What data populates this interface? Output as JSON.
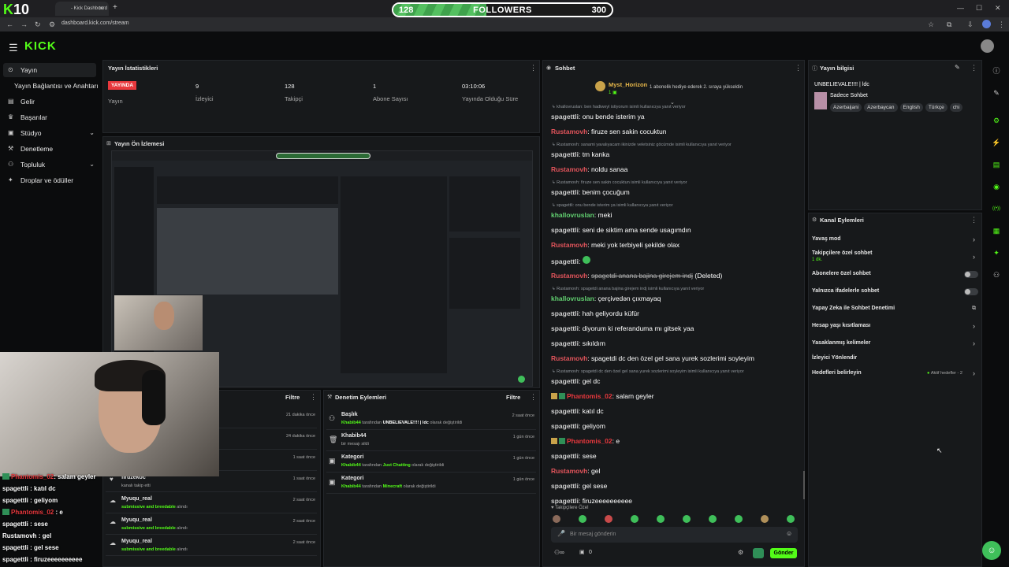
{
  "browser": {
    "tab_title": "- Kick Dashboard",
    "url": "dashboard.kick.com/stream",
    "overlay_logo_number": "10"
  },
  "followers_goal": {
    "current": "128",
    "label": "FOLLOWERS",
    "target": "300",
    "progress_fraction": 0.427
  },
  "app": {
    "logo": "KICK"
  },
  "sidebar": {
    "items": [
      {
        "label": "Yayın",
        "icon": "broadcast-icon",
        "active": true
      },
      {
        "label": "Yayın Bağlantısı ve Anahtarı",
        "icon": "",
        "active": false
      },
      {
        "label": "Gelir",
        "icon": "wallet-icon",
        "active": false
      },
      {
        "label": "Başarılar",
        "icon": "trophy-icon",
        "active": false
      },
      {
        "label": "Stüdyo",
        "icon": "studio-icon",
        "active": false,
        "chevron": true
      },
      {
        "label": "Denetleme",
        "icon": "hammer-icon",
        "active": false
      },
      {
        "label": "Topluluk",
        "icon": "people-icon",
        "active": false,
        "chevron": true
      },
      {
        "label": "Droplar ve ödüller",
        "icon": "gift-icon",
        "active": false
      }
    ]
  },
  "stream_stats": {
    "title": "Yayın İstatistikleri",
    "live_badge": "YAYINDA",
    "status_label": "Yayın",
    "viewers": "9",
    "viewers_label": "İzleyici",
    "followers": "128",
    "followers_label": "Takipçi",
    "subs": "1",
    "subs_label": "Abone Sayısı",
    "uptime": "03:10:06",
    "uptime_label": "Yayında Olduğu Süre"
  },
  "preview": {
    "title": "Yayın Ön İzlemesi"
  },
  "left_log": {
    "filter": "Filtre",
    "rows": [
      {
        "time": "21 dakika önce"
      },
      {
        "time": "24 dakika önce"
      },
      {
        "time": "1 saat önce"
      },
      {
        "title": "firuzekoc",
        "sub": "kanalı takip etti",
        "time": "1 saat önce"
      },
      {
        "title": "Myuqu_real",
        "sub_green": "submissive and breedable",
        "sub": " alındı",
        "time": "2 saat önce"
      },
      {
        "title": "Myuqu_real",
        "sub_green": "submissive and breedable",
        "sub": " alındı",
        "time": "2 saat önce"
      },
      {
        "title": "Myuqu_real",
        "sub_green": "submissive and breedable",
        "sub": " alındı",
        "time": "2 saat önce"
      }
    ]
  },
  "mod_log": {
    "title": "Denetim Eylemleri",
    "filter": "Filtre",
    "rows": [
      {
        "title": "Başlık",
        "actor": "Khabib44",
        "sub": " tarafından ",
        "value": "UNBELIEVALE!!!! | ldc",
        "suffix": " olarak değiştirildi",
        "time": "2 saat önce"
      },
      {
        "title": "Khabib44",
        "sub": "bir mesajı sildi",
        "time": "1 gün önce"
      },
      {
        "title": "Kategori",
        "actor": "Khabib44",
        "sub": " tarafından ",
        "value": "Just Chatting",
        "suffix": " olarak değiştirildi",
        "time": "1 gün önce"
      },
      {
        "title": "Kategori",
        "actor": "Khabib44",
        "sub": " tarafından ",
        "value": "Minecraft",
        "suffix": " olarak değiştirildi",
        "time": "1 gün önce"
      }
    ]
  },
  "chat": {
    "title": "Sohbet",
    "pinned_user": "Myst_Horizon",
    "pinned_text": "1 abonelik hediye ederek 2. sıraya yükseldin",
    "lines": [
      {
        "type": "reply",
        "text": "khallovruslan: ben hadiweyl istiyorum isimli kullanıcıya yanıt veriyor"
      },
      {
        "type": "msg",
        "user": "spagettli",
        "color": "u-gray",
        "text": "onu bende isterim ya"
      },
      {
        "type": "msg",
        "user": "Rustamovh",
        "color": "u-pink",
        "text": "firuze sen sakin cocuktun"
      },
      {
        "type": "reply",
        "text": "Rustamovh: sanami yavalıyacam ikinizde veletsiniz göcümde isimli kullanıcıya yanıt veriyor"
      },
      {
        "type": "msg",
        "user": "spagettli",
        "color": "u-gray",
        "text": "tm kanka"
      },
      {
        "type": "msg",
        "user": "Rustamovh",
        "color": "u-pink",
        "text": "noldu sanaa"
      },
      {
        "type": "reply",
        "text": "Rustamovh: firuze sen sakin cocuktun isimli kullanıcıya yanıt veriyor"
      },
      {
        "type": "msg",
        "user": "spagettli",
        "color": "u-gray",
        "text": "benim çocuğum"
      },
      {
        "type": "reply",
        "text": "spagettli: onu bende isterim ya isimli kullanıcıya yanıt veriyor"
      },
      {
        "type": "msg",
        "user": "khallovruslan",
        "color": "u-green",
        "text": "meki"
      },
      {
        "type": "msg",
        "user": "spagettli",
        "color": "u-gray",
        "text": "seni de siktim ama sende usagımdın"
      },
      {
        "type": "msg",
        "user": "Rustamovh",
        "color": "u-pink",
        "text": "meki yok terbiyeli şekilde olax"
      },
      {
        "type": "msg",
        "user": "spagettli",
        "color": "u-gray",
        "text": "",
        "emote": true
      },
      {
        "type": "msg",
        "user": "Rustamovh",
        "color": "u-pink",
        "text": "spagetdi anana bajina girejem indj",
        "deleted": "(Deleted)"
      },
      {
        "type": "reply",
        "text": "Rustamovh: spagetdi anana bajina girejem indj isimli kullanıcıya yanıt veriyor"
      },
      {
        "type": "msg",
        "user": "khallovruslan",
        "color": "u-green",
        "text": "çerçivedən çıxmayaq"
      },
      {
        "type": "msg",
        "user": "spagettli",
        "color": "u-gray",
        "text": "hah geliyordu küfür"
      },
      {
        "type": "msg",
        "user": "spagettli",
        "color": "u-gray",
        "text": "diyorum ki referanduma mı gitsek yaa"
      },
      {
        "type": "msg",
        "user": "spagettli",
        "color": "u-gray",
        "text": "sıkıldım"
      },
      {
        "type": "msg",
        "user": "Rustamovh",
        "color": "u-pink",
        "text": "spagetdi dc den özel gel sana yurek sozlerimi soyleyim"
      },
      {
        "type": "reply",
        "text": "Rustamovh: spagetdi dc den özel gel sana yurek sozlerimi soyleyim isimli kullanıcıya yanıt veriyor"
      },
      {
        "type": "msg",
        "user": "spagettli",
        "color": "u-gray",
        "text": "gel dc"
      },
      {
        "type": "msg",
        "user": "Phantomis_02",
        "color": "u-red",
        "text": "salam geyler",
        "badges": true
      },
      {
        "type": "msg",
        "user": "spagettli",
        "color": "u-gray",
        "text": "katıl dc"
      },
      {
        "type": "msg",
        "user": "spagettli",
        "color": "u-gray",
        "text": "geliyom"
      },
      {
        "type": "msg",
        "user": "Phantomis_02",
        "color": "u-red",
        "text": "e",
        "badges": true
      },
      {
        "type": "msg",
        "user": "spagettli",
        "color": "u-gray",
        "text": "sese"
      },
      {
        "type": "msg",
        "user": "Rustamovh",
        "color": "u-pink",
        "text": "gel"
      },
      {
        "type": "msg",
        "user": "spagettli",
        "color": "u-gray",
        "text": "gel sese"
      },
      {
        "type": "msg",
        "user": "spagettli",
        "color": "u-gray",
        "text": "firuzeeeeeeeeee"
      }
    ],
    "follower_only": "Takipçilere Özel",
    "input_placeholder": "Bir mesaj gönderin",
    "points": "0",
    "send_label": "Gönder"
  },
  "overlay_chat": [
    {
      "user": "Phantomis_02",
      "text": ": salam geyler",
      "red": true
    },
    {
      "user": "spagettli",
      "text": " : katıl dc"
    },
    {
      "user": "spagettli",
      "text": " : geliyom"
    },
    {
      "user": "Phantomis_02",
      "text": " : e",
      "red": true
    },
    {
      "user": "spagettli",
      "text": " : sese"
    },
    {
      "user": "Rustamovh",
      "text": " : gel"
    },
    {
      "user": "spagettli",
      "text": " : gel sese"
    },
    {
      "user": "spagettli",
      "text": " : firuzeeeeeeeeee"
    }
  ],
  "stream_info": {
    "title": "Yayın bilgisi",
    "stream_title": "UNBELIEVALE!!!! | ldc",
    "category": "Sadece Sohbet",
    "tags": [
      "Azerbaijani",
      "Azerbaycan",
      "English",
      "Türkçe",
      "chi"
    ]
  },
  "channel_actions": {
    "title": "Kanal Eylemleri",
    "items": [
      {
        "label": "Yavaş mod",
        "control": "chevron"
      },
      {
        "label": "Takipçilere özel sohbet",
        "sub": "1 dk.",
        "control": "chevron"
      },
      {
        "label": "Abonelere özel sohbet",
        "control": "toggle"
      },
      {
        "label": "Yalnızca ifadelerle sohbet",
        "control": "toggle"
      },
      {
        "label": "Yapay Zeka ile Sohbet Denetimi",
        "control": "external"
      },
      {
        "label": "Hesap yaşı kısıtlaması",
        "control": "chevron"
      },
      {
        "label": "Yasaklanmış kelimeler",
        "control": "chevron"
      },
      {
        "label": "İzleyici Yönlendir",
        "control": "none"
      },
      {
        "label": "Hedefleri belirleyin",
        "control": "chevron",
        "extra": "Aktif hedefler - 2"
      }
    ]
  },
  "colors": {
    "accent": "#53fc18",
    "live": "#e8383d",
    "panel": "#17191b"
  }
}
